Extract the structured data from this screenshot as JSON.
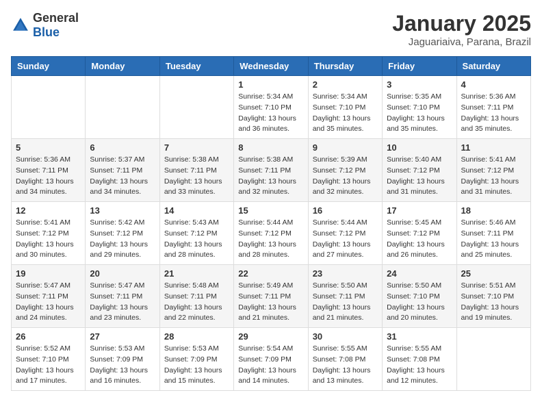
{
  "header": {
    "logo": {
      "general": "General",
      "blue": "Blue"
    },
    "title": "January 2025",
    "location": "Jaguariaiva, Parana, Brazil"
  },
  "calendar": {
    "days_of_week": [
      "Sunday",
      "Monday",
      "Tuesday",
      "Wednesday",
      "Thursday",
      "Friday",
      "Saturday"
    ],
    "weeks": [
      [
        {
          "day": "",
          "info": ""
        },
        {
          "day": "",
          "info": ""
        },
        {
          "day": "",
          "info": ""
        },
        {
          "day": "1",
          "info": "Sunrise: 5:34 AM\nSunset: 7:10 PM\nDaylight: 13 hours\nand 36 minutes."
        },
        {
          "day": "2",
          "info": "Sunrise: 5:34 AM\nSunset: 7:10 PM\nDaylight: 13 hours\nand 35 minutes."
        },
        {
          "day": "3",
          "info": "Sunrise: 5:35 AM\nSunset: 7:10 PM\nDaylight: 13 hours\nand 35 minutes."
        },
        {
          "day": "4",
          "info": "Sunrise: 5:36 AM\nSunset: 7:11 PM\nDaylight: 13 hours\nand 35 minutes."
        }
      ],
      [
        {
          "day": "5",
          "info": "Sunrise: 5:36 AM\nSunset: 7:11 PM\nDaylight: 13 hours\nand 34 minutes."
        },
        {
          "day": "6",
          "info": "Sunrise: 5:37 AM\nSunset: 7:11 PM\nDaylight: 13 hours\nand 34 minutes."
        },
        {
          "day": "7",
          "info": "Sunrise: 5:38 AM\nSunset: 7:11 PM\nDaylight: 13 hours\nand 33 minutes."
        },
        {
          "day": "8",
          "info": "Sunrise: 5:38 AM\nSunset: 7:11 PM\nDaylight: 13 hours\nand 32 minutes."
        },
        {
          "day": "9",
          "info": "Sunrise: 5:39 AM\nSunset: 7:12 PM\nDaylight: 13 hours\nand 32 minutes."
        },
        {
          "day": "10",
          "info": "Sunrise: 5:40 AM\nSunset: 7:12 PM\nDaylight: 13 hours\nand 31 minutes."
        },
        {
          "day": "11",
          "info": "Sunrise: 5:41 AM\nSunset: 7:12 PM\nDaylight: 13 hours\nand 31 minutes."
        }
      ],
      [
        {
          "day": "12",
          "info": "Sunrise: 5:41 AM\nSunset: 7:12 PM\nDaylight: 13 hours\nand 30 minutes."
        },
        {
          "day": "13",
          "info": "Sunrise: 5:42 AM\nSunset: 7:12 PM\nDaylight: 13 hours\nand 29 minutes."
        },
        {
          "day": "14",
          "info": "Sunrise: 5:43 AM\nSunset: 7:12 PM\nDaylight: 13 hours\nand 28 minutes."
        },
        {
          "day": "15",
          "info": "Sunrise: 5:44 AM\nSunset: 7:12 PM\nDaylight: 13 hours\nand 28 minutes."
        },
        {
          "day": "16",
          "info": "Sunrise: 5:44 AM\nSunset: 7:12 PM\nDaylight: 13 hours\nand 27 minutes."
        },
        {
          "day": "17",
          "info": "Sunrise: 5:45 AM\nSunset: 7:12 PM\nDaylight: 13 hours\nand 26 minutes."
        },
        {
          "day": "18",
          "info": "Sunrise: 5:46 AM\nSunset: 7:11 PM\nDaylight: 13 hours\nand 25 minutes."
        }
      ],
      [
        {
          "day": "19",
          "info": "Sunrise: 5:47 AM\nSunset: 7:11 PM\nDaylight: 13 hours\nand 24 minutes."
        },
        {
          "day": "20",
          "info": "Sunrise: 5:47 AM\nSunset: 7:11 PM\nDaylight: 13 hours\nand 23 minutes."
        },
        {
          "day": "21",
          "info": "Sunrise: 5:48 AM\nSunset: 7:11 PM\nDaylight: 13 hours\nand 22 minutes."
        },
        {
          "day": "22",
          "info": "Sunrise: 5:49 AM\nSunset: 7:11 PM\nDaylight: 13 hours\nand 21 minutes."
        },
        {
          "day": "23",
          "info": "Sunrise: 5:50 AM\nSunset: 7:11 PM\nDaylight: 13 hours\nand 21 minutes."
        },
        {
          "day": "24",
          "info": "Sunrise: 5:50 AM\nSunset: 7:10 PM\nDaylight: 13 hours\nand 20 minutes."
        },
        {
          "day": "25",
          "info": "Sunrise: 5:51 AM\nSunset: 7:10 PM\nDaylight: 13 hours\nand 19 minutes."
        }
      ],
      [
        {
          "day": "26",
          "info": "Sunrise: 5:52 AM\nSunset: 7:10 PM\nDaylight: 13 hours\nand 17 minutes."
        },
        {
          "day": "27",
          "info": "Sunrise: 5:53 AM\nSunset: 7:09 PM\nDaylight: 13 hours\nand 16 minutes."
        },
        {
          "day": "28",
          "info": "Sunrise: 5:53 AM\nSunset: 7:09 PM\nDaylight: 13 hours\nand 15 minutes."
        },
        {
          "day": "29",
          "info": "Sunrise: 5:54 AM\nSunset: 7:09 PM\nDaylight: 13 hours\nand 14 minutes."
        },
        {
          "day": "30",
          "info": "Sunrise: 5:55 AM\nSunset: 7:08 PM\nDaylight: 13 hours\nand 13 minutes."
        },
        {
          "day": "31",
          "info": "Sunrise: 5:55 AM\nSunset: 7:08 PM\nDaylight: 13 hours\nand 12 minutes."
        },
        {
          "day": "",
          "info": ""
        }
      ]
    ]
  }
}
